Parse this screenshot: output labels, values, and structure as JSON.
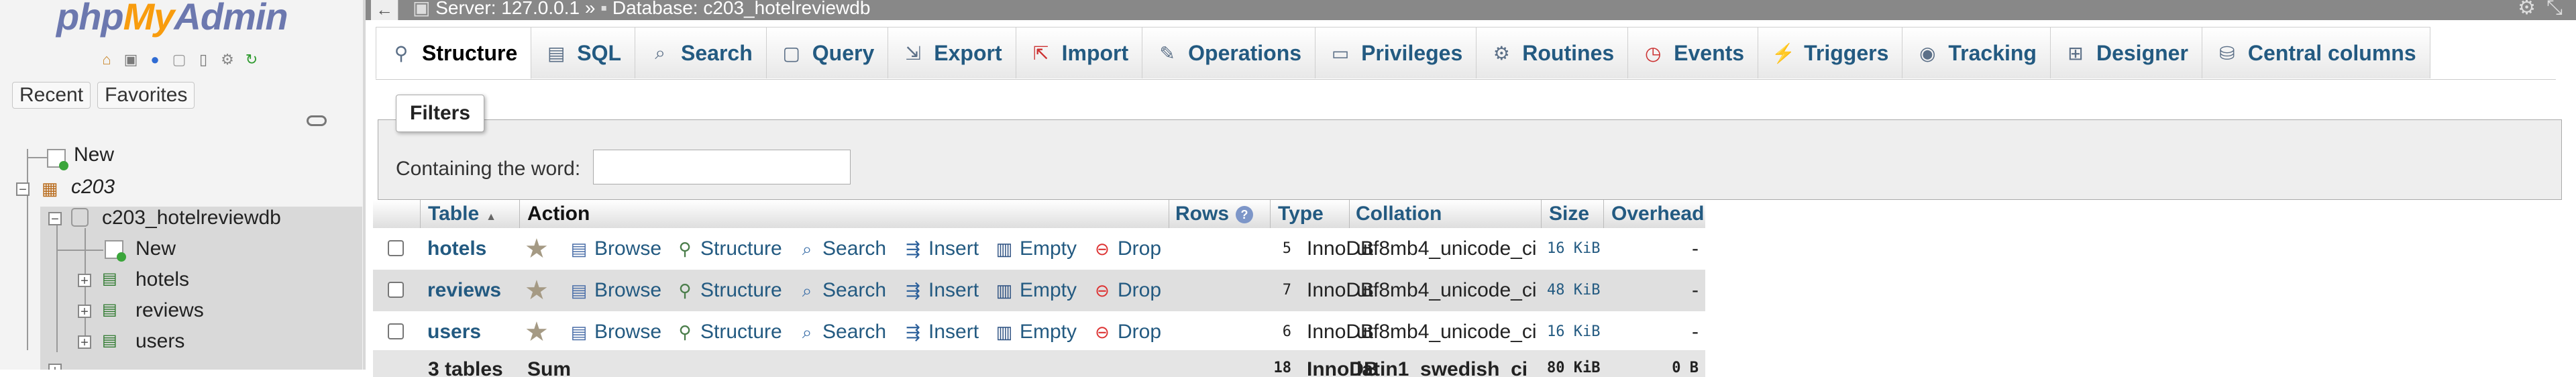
{
  "logo": {
    "php": "php",
    "my": "My",
    "admin": "Admin"
  },
  "nav_icons": [
    "home-icon",
    "logout-icon",
    "query-window-icon",
    "docs-icon",
    "docs-alt-icon",
    "settings-icon",
    "reload-icon"
  ],
  "left_tabs": {
    "recent": "Recent",
    "favorites": "Favorites"
  },
  "tree": {
    "new_root": "New",
    "server_group": "c203",
    "database": "c203_hotelreviewdb",
    "db_new": "New",
    "tables": [
      "hotels",
      "reviews",
      "users"
    ]
  },
  "topbar": {
    "server": "Server: 127.0.0.1",
    "separator": "»",
    "database": "Database: c203_hotelreviewdb"
  },
  "tabs": [
    {
      "label": "Structure",
      "icon": "structure-icon",
      "active": true
    },
    {
      "label": "SQL",
      "icon": "sql-icon"
    },
    {
      "label": "Search",
      "icon": "search-icon"
    },
    {
      "label": "Query",
      "icon": "query-icon"
    },
    {
      "label": "Export",
      "icon": "export-icon"
    },
    {
      "label": "Import",
      "icon": "import-icon"
    },
    {
      "label": "Operations",
      "icon": "operations-icon"
    },
    {
      "label": "Privileges",
      "icon": "privileges-icon"
    },
    {
      "label": "Routines",
      "icon": "routines-icon"
    },
    {
      "label": "Events",
      "icon": "events-icon"
    },
    {
      "label": "Triggers",
      "icon": "triggers-icon"
    },
    {
      "label": "Tracking",
      "icon": "tracking-icon"
    },
    {
      "label": "Designer",
      "icon": "designer-icon"
    },
    {
      "label": "Central columns",
      "icon": "central-columns-icon"
    }
  ],
  "filters": {
    "legend": "Filters",
    "label": "Containing the word:",
    "value": ""
  },
  "table": {
    "headers": {
      "table": "Table",
      "action": "Action",
      "rows": "Rows",
      "type": "Type",
      "collation": "Collation",
      "size": "Size",
      "overhead": "Overhead"
    },
    "actions": {
      "browse": "Browse",
      "structure": "Structure",
      "search": "Search",
      "insert": "Insert",
      "empty": "Empty",
      "drop": "Drop"
    },
    "rows": [
      {
        "name": "hotels",
        "rows": "5",
        "type": "InnoDB",
        "collation": "utf8mb4_unicode_ci",
        "size": "16 KiB",
        "overhead": "-"
      },
      {
        "name": "reviews",
        "rows": "7",
        "type": "InnoDB",
        "collation": "utf8mb4_unicode_ci",
        "size": "48 KiB",
        "overhead": "-"
      },
      {
        "name": "users",
        "rows": "6",
        "type": "InnoDB",
        "collation": "utf8mb4_unicode_ci",
        "size": "16 KiB",
        "overhead": "-"
      }
    ],
    "summary": {
      "label": "3 tables",
      "sum": "Sum",
      "rows": "18",
      "type": "InnoDB",
      "collation": "latin1_swedish_ci",
      "size": "80 KiB",
      "overhead": "0 B"
    }
  }
}
